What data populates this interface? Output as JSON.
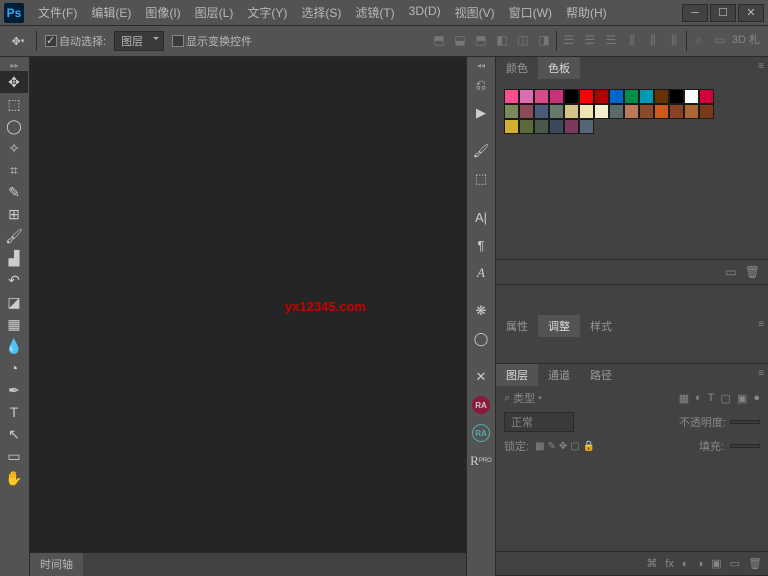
{
  "app": {
    "logo": "Ps"
  },
  "menu": [
    "文件(F)",
    "编辑(E)",
    "图像(I)",
    "图层(L)",
    "文字(Y)",
    "选择(S)",
    "滤镜(T)",
    "3D(D)",
    "视图(V)",
    "窗口(W)",
    "帮助(H)"
  ],
  "options": {
    "auto_select_label": "自动选择:",
    "auto_select_target": "图层",
    "show_transform": "显示变换控件",
    "threeD": "3D 札"
  },
  "watermark": "yx12345.com",
  "bottom_tab": "时间轴",
  "right": {
    "color_tabs": [
      "颜色",
      "色板"
    ],
    "swatches": [
      [
        "#ff4d8f",
        "#e06bb3",
        "#d94a86",
        "#c93276",
        "#000000",
        "#ff0000",
        "#b30000",
        "#0066cc",
        "#008c4a",
        "#0099b3",
        "#663300",
        "#000000",
        "#ffffff",
        "#d4003a"
      ],
      [
        "#7a8a5a",
        "#8a4a5a",
        "#4a5a7a",
        "#6a7a6a",
        "#d4c488",
        "#f0e4b0",
        "#f5edd0",
        "#5a6a6a",
        "#bb7a5a",
        "#8a4a2a",
        "#cc5a1a",
        "#884422",
        "#aa6633",
        "#7a3a1a"
      ],
      [
        "#d4b030",
        "#5a6a3a",
        "#4a5a4a",
        "#3a4a5a",
        "#7a3a5a",
        "#556677"
      ]
    ],
    "adj_tabs": [
      "属性",
      "调整",
      "样式"
    ],
    "layer_tabs": [
      "图层",
      "通道",
      "路径"
    ],
    "layers": {
      "search_label": "类型",
      "blend_mode": "正常",
      "opacity_label": "不透明度:",
      "lock_label": "锁定:",
      "fill_label": "填充:"
    }
  }
}
